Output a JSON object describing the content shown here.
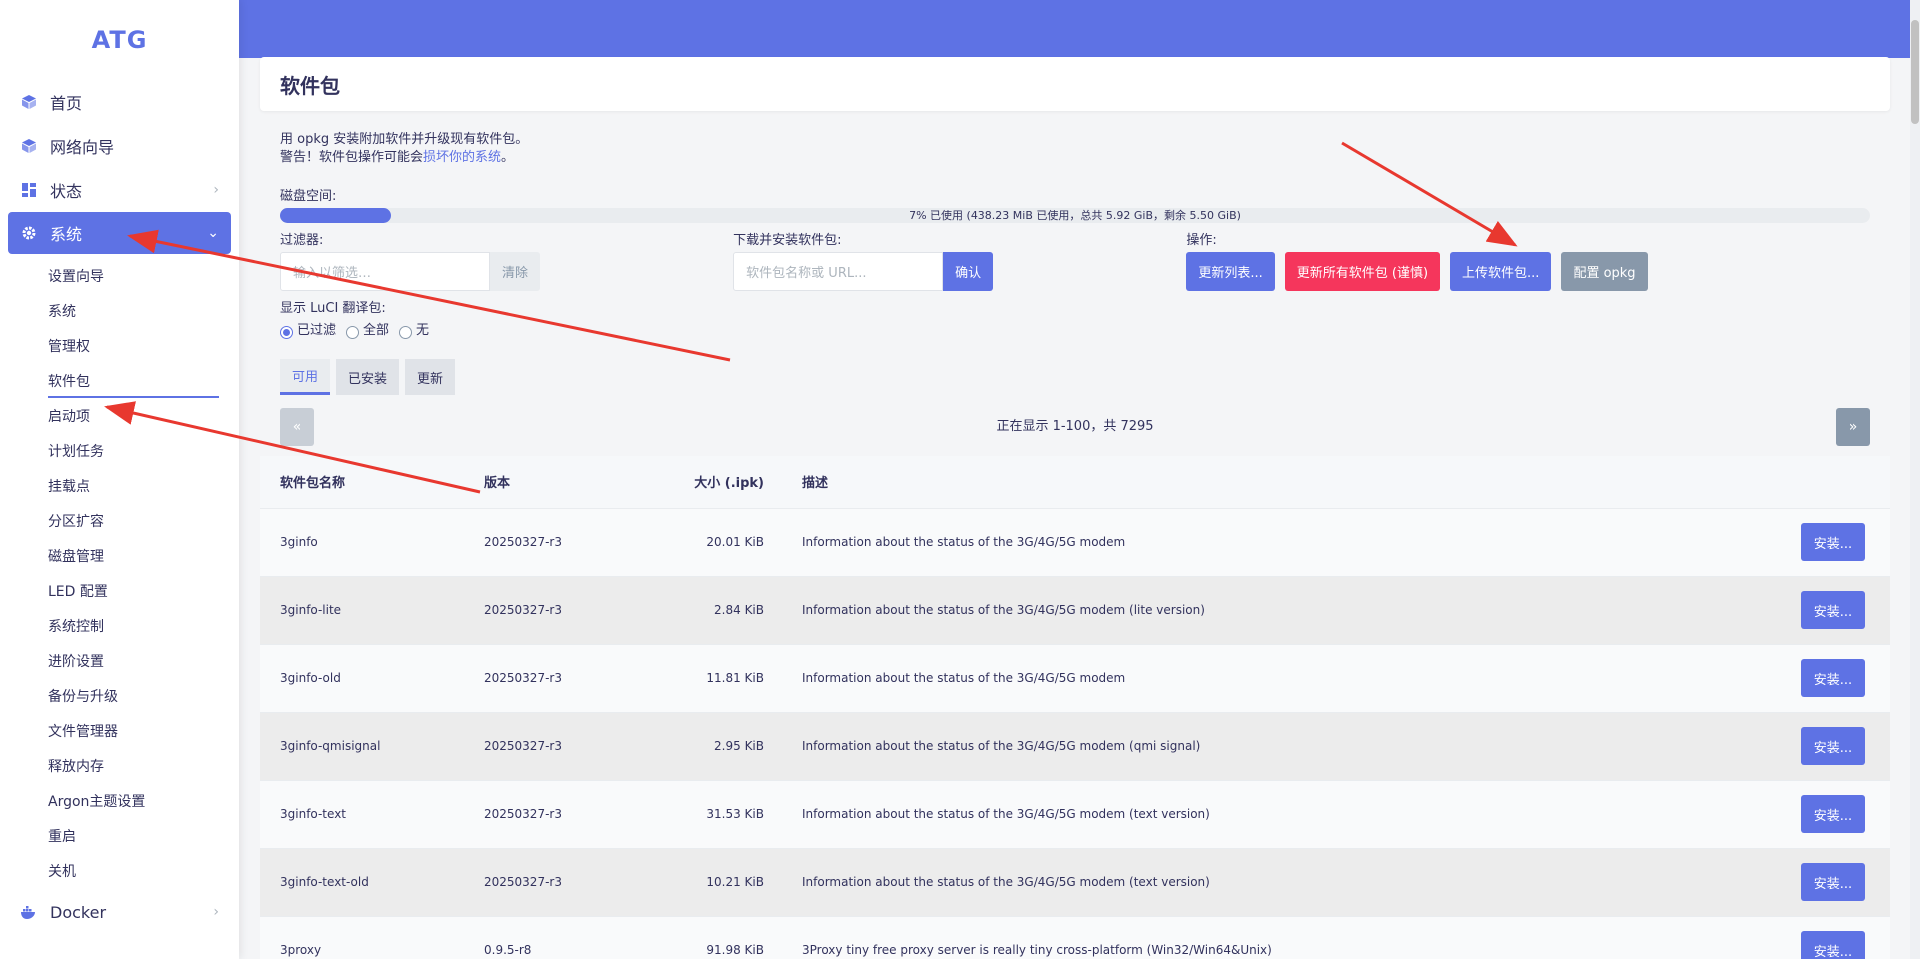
{
  "brand": "ATG",
  "sidebar": {
    "items": [
      {
        "label": "首页",
        "icon": "cube-icon"
      },
      {
        "label": "网络向导",
        "icon": "cube-icon"
      },
      {
        "label": "状态",
        "icon": "dashboard-icon"
      },
      {
        "label": "系统",
        "icon": "gear-icon"
      }
    ],
    "sub_items": [
      "设置向导",
      "系统",
      "管理权",
      "软件包",
      "启动项",
      "计划任务",
      "挂载点",
      "分区扩容",
      "磁盘管理",
      "LED 配置",
      "系统控制",
      "进阶设置",
      "备份与升级",
      "文件管理器",
      "释放内存",
      "Argon主题设置",
      "重启",
      "关机"
    ],
    "docker": "Docker"
  },
  "page": {
    "title": "软件包",
    "desc_line1": "用 opkg 安装附加软件并升级现有软件包。",
    "desc_line2_prefix": "警告！软件包操作可能会",
    "desc_line2_link": "损坏你的系统",
    "desc_line2_suffix": "。",
    "disk_label": "磁盘空间:",
    "disk_text": "7% 已使用 (438.23 MiB 已使用，总共 5.92 GiB，剩余 5.50 GiB)",
    "disk_used_percent": 7,
    "filter_label": "过滤器:",
    "filter_placeholder": "输入以筛选…",
    "clear_label": "清除",
    "download_label": "下载并安装软件包:",
    "download_placeholder": "软件包名称或 URL...",
    "confirm_label": "确认",
    "ops_label": "操作:",
    "ops": {
      "update_lists": "更新列表...",
      "upgrade_all": "更新所有软件包 (谨慎)",
      "upload": "上传软件包...",
      "config": "配置 opkg"
    },
    "luci_label": "显示 LuCI 翻译包:",
    "radios": [
      "已过滤",
      "全部",
      "无"
    ],
    "tabs": [
      "可用",
      "已安装",
      "更新"
    ],
    "pager_prev": "«",
    "pager_next": "»",
    "pager_text": "正在显示 1-100，共 7295"
  },
  "table": {
    "headers": [
      "软件包名称",
      "版本",
      "大小 (.ipk)",
      "描述"
    ],
    "install_label": "安装...",
    "rows": [
      {
        "name": "3ginfo",
        "version": "20250327-r3",
        "size": "20.01 KiB",
        "desc": "Information about the status of the 3G/4G/5G modem"
      },
      {
        "name": "3ginfo-lite",
        "version": "20250327-r3",
        "size": "2.84 KiB",
        "desc": "Information about the status of the 3G/4G/5G modem (lite version)"
      },
      {
        "name": "3ginfo-old",
        "version": "20250327-r3",
        "size": "11.81 KiB",
        "desc": "Information about the status of the 3G/4G/5G modem"
      },
      {
        "name": "3ginfo-qmisignal",
        "version": "20250327-r3",
        "size": "2.95 KiB",
        "desc": "Information about the status of the 3G/4G/5G modem (qmi signal)"
      },
      {
        "name": "3ginfo-text",
        "version": "20250327-r3",
        "size": "31.53 KiB",
        "desc": "Information about the status of the 3G/4G/5G modem (text version)"
      },
      {
        "name": "3ginfo-text-old",
        "version": "20250327-r3",
        "size": "10.21 KiB",
        "desc": "Information about the status of the 3G/4G/5G modem (text version)"
      },
      {
        "name": "3proxy",
        "version": "0.9.5-r8",
        "size": "91.98 KiB",
        "desc": "3Proxy tiny free proxy server is really tiny cross-platform (Win32/Win64&Unix)"
      }
    ]
  },
  "colors": {
    "primary": "#5e72e4",
    "danger": "#f5365c",
    "gray": "#8898aa",
    "annotation": "#e8382f"
  }
}
